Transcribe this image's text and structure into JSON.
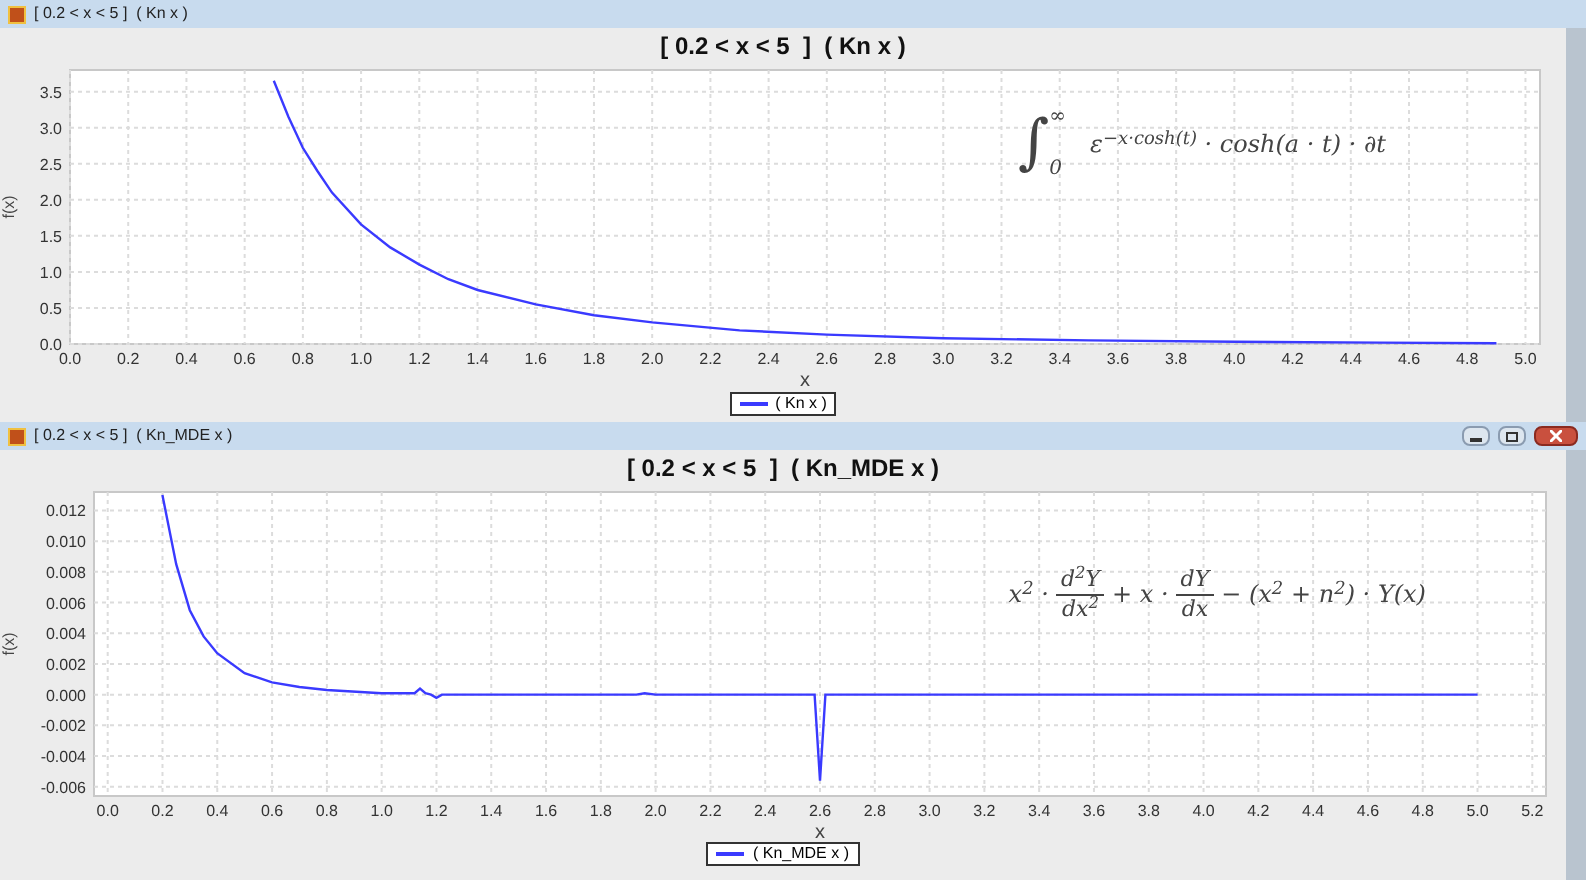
{
  "windows": [
    {
      "title": "[ 0.2 < x < 5 ]  ( Kn x )",
      "controls": false,
      "formula": {
        "kind": "integral",
        "symbol": "∫",
        "lower": "0",
        "upper": "∞",
        "body": "ε$^{−x·cosh(t)}$ · cosh(a · t) · ∂t"
      },
      "chart_data": {
        "type": "line",
        "title": "[ 0.2 < x < 5  ]  ( Kn x )",
        "xlabel": "x",
        "ylabel": "f(x)",
        "x": [
          0.7,
          0.75,
          0.8,
          0.85,
          0.9,
          1.0,
          1.1,
          1.2,
          1.3,
          1.4,
          1.6,
          1.8,
          2.0,
          2.3,
          2.6,
          3.0,
          3.5,
          4.0,
          4.5,
          4.9
        ],
        "series": [
          {
            "name": "( Kn x )",
            "color": "#3a3aff",
            "values": [
              3.65,
              3.15,
              2.72,
              2.4,
              2.1,
              1.66,
              1.34,
              1.1,
              0.9,
              0.75,
              0.55,
              0.4,
              0.3,
              0.19,
              0.13,
              0.08,
              0.05,
              0.03,
              0.02,
              0.01
            ]
          }
        ],
        "xlim": [
          0,
          5.05
        ],
        "ylim": [
          0,
          3.8
        ],
        "grid": true,
        "xticks": [
          {
            "value": 0,
            "label": "0.0"
          },
          {
            "value": 0.2,
            "label": "0.2"
          },
          {
            "value": 0.4,
            "label": "0.4"
          },
          {
            "value": 0.6,
            "label": "0.6"
          },
          {
            "value": 0.8,
            "label": "0.8"
          },
          {
            "value": 1,
            "label": "1.0"
          },
          {
            "value": 1.2,
            "label": "1.2"
          },
          {
            "value": 1.4,
            "label": "1.4"
          },
          {
            "value": 1.6,
            "label": "1.6"
          },
          {
            "value": 1.8,
            "label": "1.8"
          },
          {
            "value": 2,
            "label": "2.0"
          },
          {
            "value": 2.2,
            "label": "2.2"
          },
          {
            "value": 2.4,
            "label": "2.4"
          },
          {
            "value": 2.6,
            "label": "2.6"
          },
          {
            "value": 2.8,
            "label": "2.8"
          },
          {
            "value": 3,
            "label": "3.0"
          },
          {
            "value": 3.2,
            "label": "3.2"
          },
          {
            "value": 3.4,
            "label": "3.4"
          },
          {
            "value": 3.6,
            "label": "3.6"
          },
          {
            "value": 3.8,
            "label": "3.8"
          },
          {
            "value": 4,
            "label": "4.0"
          },
          {
            "value": 4.2,
            "label": "4.2"
          },
          {
            "value": 4.4,
            "label": "4.4"
          },
          {
            "value": 4.6,
            "label": "4.6"
          },
          {
            "value": 4.8,
            "label": "4.8"
          },
          {
            "value": 5,
            "label": "5.0"
          }
        ],
        "yticks": [
          {
            "value": 0,
            "label": "0.0"
          },
          {
            "value": 0.5,
            "label": "0.5"
          },
          {
            "value": 1,
            "label": "1.0"
          },
          {
            "value": 1.5,
            "label": "1.5"
          },
          {
            "value": 2,
            "label": "2.0"
          },
          {
            "value": 2.5,
            "label": "2.5"
          },
          {
            "value": 3,
            "label": "3.0"
          },
          {
            "value": 3.5,
            "label": "3.5"
          }
        ]
      }
    },
    {
      "title": "[ 0.2 < x < 5 ]  ( Kn_MDE x )",
      "controls": true,
      "formula": {
        "kind": "terms",
        "terms": [
          {
            "kind": "text",
            "text": "x$^{2}$ ·"
          },
          {
            "kind": "frac",
            "num": "d$^{2}$Y",
            "den": "dx$^{2}$"
          },
          {
            "kind": "text",
            "text": "+ x ·"
          },
          {
            "kind": "frac",
            "num": "dY",
            "den": "dx"
          },
          {
            "kind": "text",
            "text": "− (x$^{2}$ + n$^{2}$) · Y(x)"
          }
        ]
      },
      "chart_data": {
        "type": "line",
        "title": "[ 0.2 < x < 5  ]  ( Kn_MDE x )",
        "xlabel": "x",
        "ylabel": "f(x)",
        "x": [
          0.2,
          0.25,
          0.3,
          0.35,
          0.4,
          0.5,
          0.6,
          0.7,
          0.8,
          1.0,
          1.12,
          1.14,
          1.16,
          1.18,
          1.2,
          1.22,
          1.25,
          1.5,
          1.93,
          1.96,
          2.0,
          2.5,
          2.58,
          2.6,
          2.62,
          3.0,
          4.0,
          5.0
        ],
        "series": [
          {
            "name": "( Kn_MDE x )",
            "color": "#3a3aff",
            "values": [
              0.013,
              0.0085,
              0.0055,
              0.0038,
              0.0027,
              0.0014,
              0.0008,
              0.0005,
              0.0003,
              0.0001,
              0.0001,
              0.0004,
              0.0001,
              0.0,
              -0.0002,
              0.0,
              0.0,
              0.0,
              0.0,
              0.0001,
              0.0,
              0.0,
              0.0,
              -0.0056,
              0.0,
              0.0,
              0.0,
              0.0
            ]
          }
        ],
        "xlim": [
          -0.05,
          5.25
        ],
        "ylim": [
          -0.0066,
          0.0132
        ],
        "grid": true,
        "xticks": [
          {
            "value": 0,
            "label": "0.0"
          },
          {
            "value": 0.2,
            "label": "0.2"
          },
          {
            "value": 0.4,
            "label": "0.4"
          },
          {
            "value": 0.6,
            "label": "0.6"
          },
          {
            "value": 0.8,
            "label": "0.8"
          },
          {
            "value": 1,
            "label": "1.0"
          },
          {
            "value": 1.2,
            "label": "1.2"
          },
          {
            "value": 1.4,
            "label": "1.4"
          },
          {
            "value": 1.6,
            "label": "1.6"
          },
          {
            "value": 1.8,
            "label": "1.8"
          },
          {
            "value": 2,
            "label": "2.0"
          },
          {
            "value": 2.2,
            "label": "2.2"
          },
          {
            "value": 2.4,
            "label": "2.4"
          },
          {
            "value": 2.6,
            "label": "2.6"
          },
          {
            "value": 2.8,
            "label": "2.8"
          },
          {
            "value": 3,
            "label": "3.0"
          },
          {
            "value": 3.2,
            "label": "3.2"
          },
          {
            "value": 3.4,
            "label": "3.4"
          },
          {
            "value": 3.6,
            "label": "3.6"
          },
          {
            "value": 3.8,
            "label": "3.8"
          },
          {
            "value": 4,
            "label": "4.0"
          },
          {
            "value": 4.2,
            "label": "4.2"
          },
          {
            "value": 4.4,
            "label": "4.4"
          },
          {
            "value": 4.6,
            "label": "4.6"
          },
          {
            "value": 4.8,
            "label": "4.8"
          },
          {
            "value": 5,
            "label": "5.0"
          },
          {
            "value": 5.2,
            "label": "5.2"
          }
        ],
        "yticks": [
          {
            "value": -0.006,
            "label": "-0.006"
          },
          {
            "value": -0.004,
            "label": "-0.004"
          },
          {
            "value": -0.002,
            "label": "-0.002"
          },
          {
            "value": 0,
            "label": "0.000"
          },
          {
            "value": 0.002,
            "label": "0.002"
          },
          {
            "value": 0.004,
            "label": "0.004"
          },
          {
            "value": 0.006,
            "label": "0.006"
          },
          {
            "value": 0.008,
            "label": "0.008"
          },
          {
            "value": 0.01,
            "label": "0.010"
          },
          {
            "value": 0.012,
            "label": "0.012"
          }
        ]
      }
    }
  ]
}
